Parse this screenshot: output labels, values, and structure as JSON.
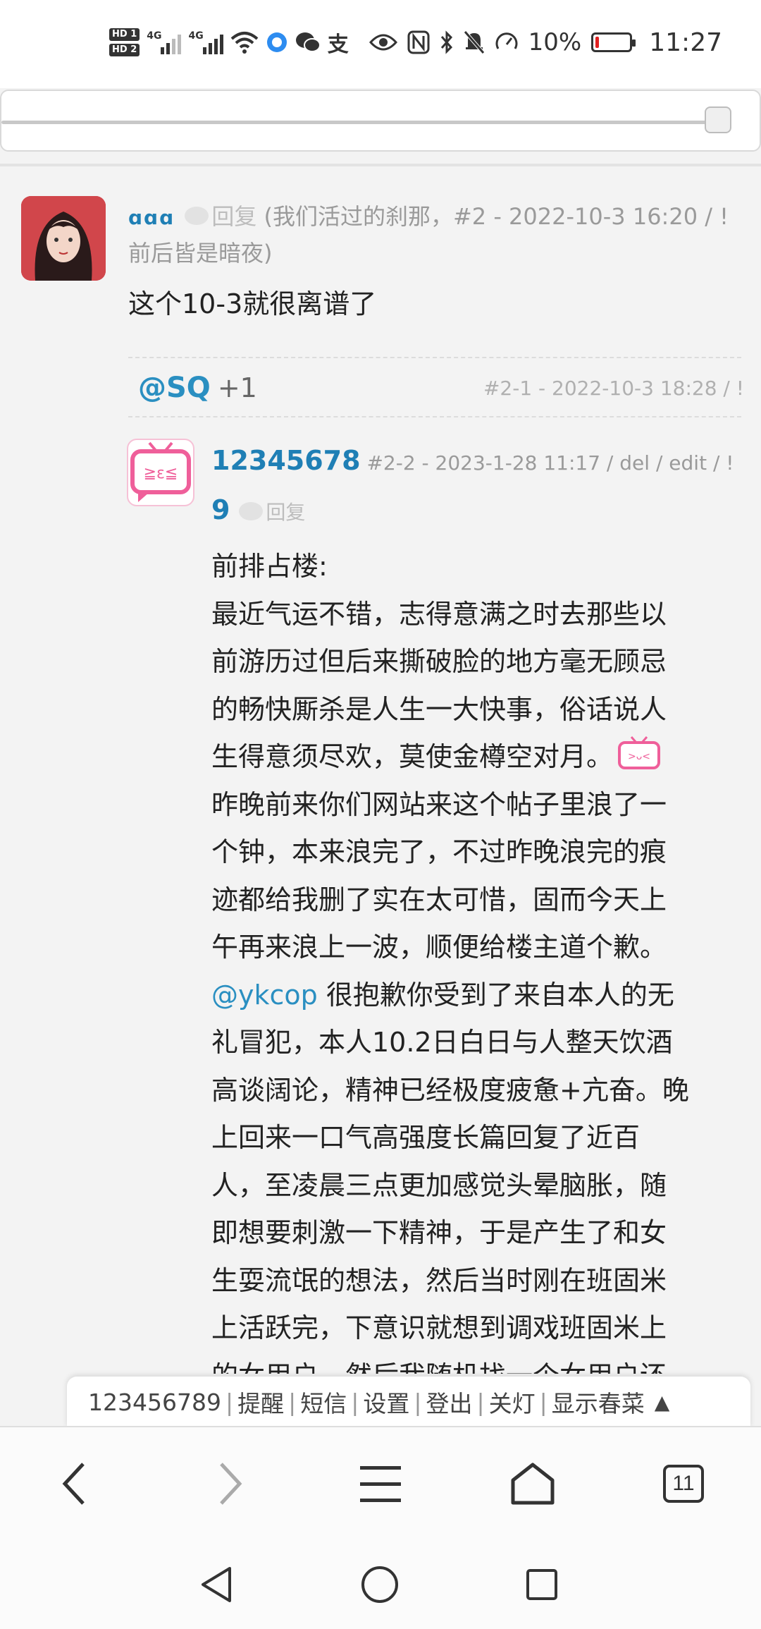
{
  "status_bar": {
    "hd1": "HD 1",
    "hd2": "HD 2",
    "net1": "4G",
    "net2": "4G",
    "battery_percent": "10%",
    "battery_level": 0.1,
    "time": "11:27",
    "icons": [
      "wifi-icon",
      "browser-app-icon",
      "wechat-icon",
      "alipay-icon",
      "eye-icon",
      "nfc-icon",
      "bluetooth-icon",
      "mute-bell-icon",
      "speed-icon"
    ]
  },
  "comments": [
    {
      "name": "ɑɑɑ",
      "reply_label": "回复",
      "quote_meta": "(我们活过的刹那，#2 - 2022-10-3 16:20 / ! 前后皆是暗夜)",
      "body": "这个10-3就很离谱了",
      "subreply": {
        "mention": "@SQ",
        "text": "+1",
        "meta": "#2-1 - 2022-10-3 18:28 / !"
      }
    },
    {
      "name": "123456789",
      "meta": "#2-2 - 2023-1-28 11:17 / del / edit / !",
      "reply_label": "回复",
      "body_lines": [
        "前排占楼:",
        "最近气运不错，志得意满之时去那些以",
        "前游历过但后来撕破脸的地方毫无顾忌",
        "的畅快厮杀是人生一大快事，俗话说人",
        "生得意须尽欢，莫使金樽空对月。",
        "昨晚前来你们网站来这个帖子里浪了一",
        "个钟，本来浪完了，不过昨晚浪完的痕",
        "迹都给我删了实在太可惜，固而今天上",
        "午再来浪上一波，顺便给楼主道个歉。",
        "很抱歉你受到了来自本人的无",
        "礼冒犯，本人10.2日白日与人整天饮酒",
        "高谈阔论，精神已经极度疲惫+亢奋。晚",
        "上回来一口气高强度长篇回复了近百",
        "人，至凌晨三点更加感觉头晕脑胀，随",
        "即想要刺激一下精神，于是产生了和女",
        "生耍流氓的想法，然后当时刚在班固米",
        "上活跃完，下意识就想到调戏班固米上",
        "的女用户，然后我随机找一个女用户还"
      ],
      "mention": "@ykcop"
    }
  ],
  "user_bar": {
    "username": "123456789",
    "items": [
      "提醒",
      "短信",
      "设置",
      "登出"
    ],
    "light": "关灯",
    "show": "显示春菜",
    "arrow": "▲"
  },
  "browser_nav": {
    "tabs_count": "11"
  }
}
